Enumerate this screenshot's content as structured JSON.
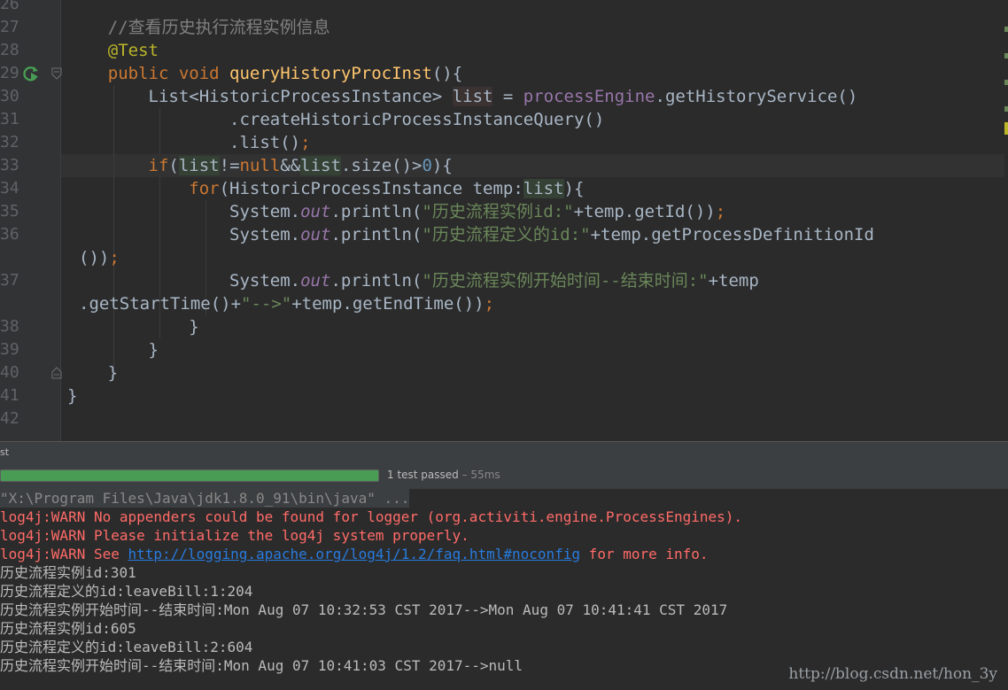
{
  "editor": {
    "line_numbers": [
      "26",
      "27",
      "28",
      "29",
      "30",
      "31",
      "32",
      "33",
      "34",
      "35",
      "36",
      "",
      "37",
      "",
      "38",
      "39",
      "40",
      "41",
      "42"
    ],
    "code": {
      "comment": "//查看历史执行流程实例信息",
      "annotation": "@Test",
      "l29_kw": "public void ",
      "l29_fn": "queryHistoryProcInst",
      "l29_rest": "(){",
      "l30_a": "List<HistoricProcessInstance> ",
      "l30_var": "list",
      "l30_b": " = ",
      "l30_field": "processEngine",
      "l30_c": ".getHistoryService()",
      "l31": ".createHistoricProcessInstanceQuery()",
      "l32_a": ".list()",
      "l32_b": ";",
      "l33_if": "if",
      "l33_a": "(",
      "l33_list1": "list",
      "l33_b": "!=",
      "l33_null": "null",
      "l33_c": "&&",
      "l33_list2": "list",
      "l33_d": ".size()>",
      "l33_zero": "0",
      "l33_e": "){",
      "l34_for": "for",
      "l34_a": "(HistoricProcessInstance temp:",
      "l34_list": "list",
      "l34_b": "){",
      "sys": "System.",
      "out": "out",
      "println": ".println(",
      "l35_str": "\"历史流程实例id:\"",
      "l35_rest": "+temp.getId())",
      "semi": ";",
      "l36_str": "\"历史流程定义的id:\"",
      "l36_rest": "+temp.getProcessDefinitionId",
      "l36w": "())",
      "l37_str": "\"历史流程实例开始时间--结束时间:\"",
      "l37_rest": "+temp",
      "l37w_a": ".getStartTime()+",
      "l37w_str": "\"-->\"",
      "l37w_b": "+temp.getEndTime())",
      "brace_close": "}"
    }
  },
  "run_tab": {
    "label": "st"
  },
  "test_result": {
    "progress_fraction": 1.0,
    "status": "1 test passed",
    "time": " – 55ms"
  },
  "console": {
    "cmd": "\"X:\\Program Files\\Java\\jdk1.8.0_91\\bin\\java\" ...",
    "warn1": "log4j:WARN No appenders could be found for logger (org.activiti.engine.ProcessEngines).",
    "warn2": "log4j:WARN Please initialize the log4j system properly.",
    "warn3_a": "log4j:WARN See ",
    "warn3_link": "http://logging.apache.org/log4j/1.2/faq.html#noconfig",
    "warn3_b": " for more info.",
    "out1": "历史流程实例id:301",
    "out2": "历史流程定义的id:leaveBill:1:204",
    "out3": "历史流程实例开始时间--结束时间:Mon Aug 07 10:32:53 CST 2017-->Mon Aug 07 10:41:41 CST 2017",
    "out4": "历史流程实例id:605",
    "out5": "历史流程定义的id:leaveBill:2:604",
    "out6": "历史流程实例开始时间--结束时间:Mon Aug 07 10:41:03 CST 2017-->null"
  },
  "watermark": "http://blog.csdn.net/hon_3y",
  "colors": {
    "run_icon": "#499c54",
    "progress": "#499c54",
    "warn": "#ff6b68",
    "link": "#287bde"
  },
  "icons": [
    "run-test-icon",
    "fold-icon"
  ]
}
